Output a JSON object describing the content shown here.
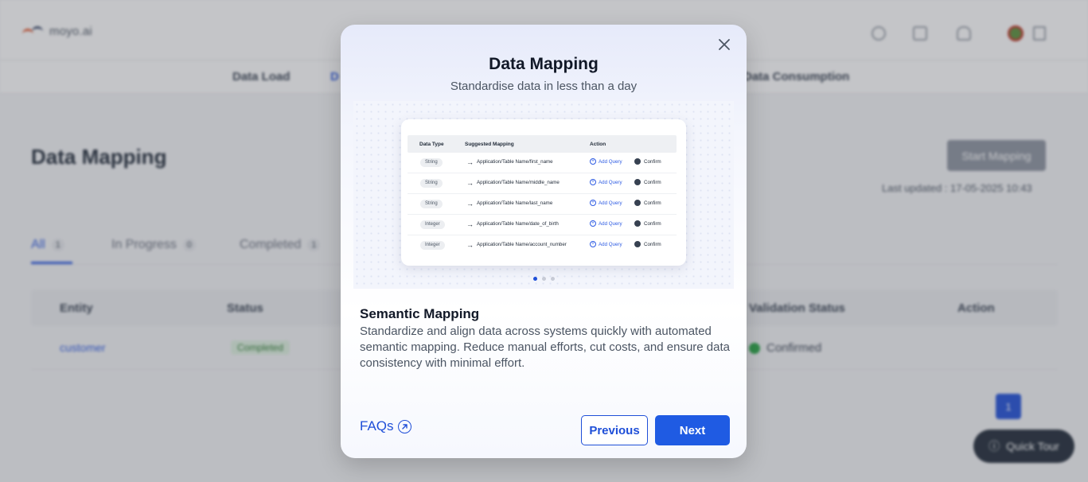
{
  "app": {
    "logo_text": "moyo.ai"
  },
  "nav": {
    "items": [
      {
        "label": "Data Load"
      },
      {
        "label": "D"
      },
      {
        "label": "Data Consumption"
      }
    ]
  },
  "page": {
    "title": "Data Mapping",
    "start_button": "Start Mapping",
    "last_updated": "Last updated : 17-05-2025 10:43"
  },
  "tabs": [
    {
      "label": "All",
      "count": "1"
    },
    {
      "label": "In Progress",
      "count": "0"
    },
    {
      "label": "Completed",
      "count": "1"
    }
  ],
  "table": {
    "headers": [
      "Entity",
      "Status",
      "Validation Status",
      "Action"
    ],
    "row": {
      "entity": "customer",
      "status": "Completed",
      "validation": "Confirmed"
    }
  },
  "pagination": {
    "current": "1"
  },
  "quick_tour": "Quick Tour",
  "modal": {
    "title": "Data Mapping",
    "subtitle": "Standardise data in less than a day",
    "illustration": {
      "headers": [
        "Data Type",
        "Suggested Mapping",
        "Action"
      ],
      "rows": [
        {
          "type": "String",
          "mapping": "Application/Table Name/first_name",
          "add": "Add Query",
          "confirm": "Confirm"
        },
        {
          "type": "String",
          "mapping": "Application/Table Name/middle_name",
          "add": "Add Query",
          "confirm": "Confirm"
        },
        {
          "type": "String",
          "mapping": "Application/Table Name/last_name",
          "add": "Add Query",
          "confirm": "Confirm"
        },
        {
          "type": "Integer",
          "mapping": "Application/Table Name/date_of_birth",
          "add": "Add Query",
          "confirm": "Confirm"
        },
        {
          "type": "Integer",
          "mapping": "Application/Table Name/account_number",
          "add": "Add Query",
          "confirm": "Confirm"
        }
      ],
      "carousel": {
        "total": 3,
        "active": 1
      }
    },
    "feature_title": "Semantic Mapping",
    "feature_description": "Standardize and align data across systems quickly with automated semantic mapping. Reduce manual efforts, cut costs, and ensure data consistency with minimal effort.",
    "faqs_label": "FAQs",
    "previous_label": "Previous",
    "next_label": "Next"
  },
  "colors": {
    "accent": "#1f5be3",
    "overlay": "#464a54"
  }
}
